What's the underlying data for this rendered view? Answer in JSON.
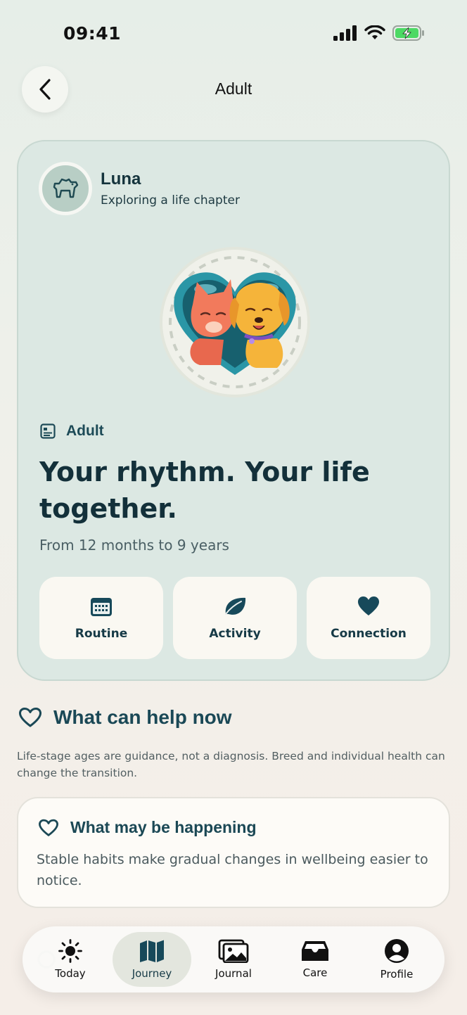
{
  "status_bar": {
    "time": "09:41"
  },
  "header": {
    "title": "Adult",
    "back_icon": "chevron-left-icon"
  },
  "pet": {
    "name": "Luna",
    "subtitle": "Exploring a life chapter",
    "avatar_icon": "dog-icon"
  },
  "stage": {
    "label": "Adult",
    "headline": "Your rhythm. Your life together.",
    "age_range": "From 12 months to 9 years",
    "tiles": [
      {
        "label": "Routine",
        "icon": "calendar-icon"
      },
      {
        "label": "Activity",
        "icon": "leaf-icon"
      },
      {
        "label": "Connection",
        "icon": "heart-icon"
      }
    ]
  },
  "help_section": {
    "title": "What can help now",
    "disclaimer": "Life-stage ages are guidance, not a diagnosis. Breed and individual health can change the transition."
  },
  "info_card": {
    "title": "What may be happening",
    "body": "Stable habits make gradual changes in wellbeing easier to notice."
  },
  "tabbar": {
    "tabs": [
      {
        "label": "Today",
        "icon": "sun-icon"
      },
      {
        "label": "Journey",
        "icon": "map-icon",
        "active": true
      },
      {
        "label": "Journal",
        "icon": "photos-icon"
      },
      {
        "label": "Care",
        "icon": "inbox-icon"
      },
      {
        "label": "Profile",
        "icon": "person-icon"
      }
    ]
  },
  "colors": {
    "accent": "#1d4a57",
    "card": "#dce8e3",
    "tile": "#faf8f2",
    "battery": "#4cd964"
  }
}
